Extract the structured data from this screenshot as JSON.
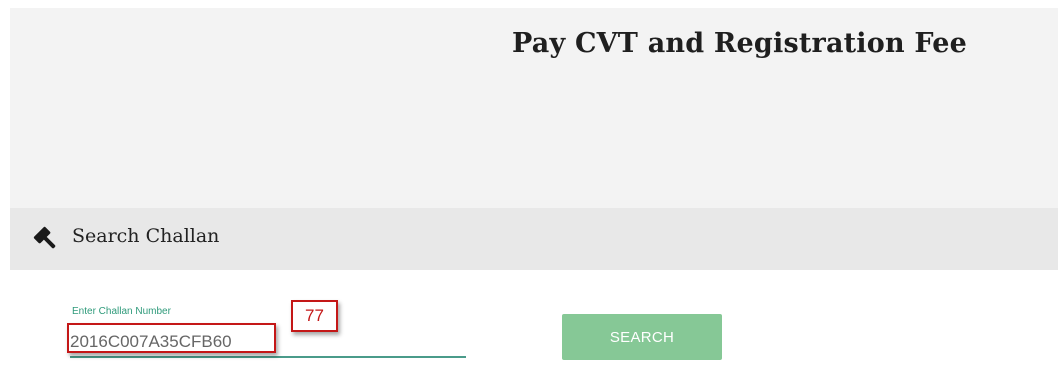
{
  "header": {
    "title": "Pay CVT and Registration Fee"
  },
  "section": {
    "title": "Search Challan",
    "icon": "gavel-icon"
  },
  "form": {
    "challan_label": "Enter Challan Number",
    "challan_value": "2016C007A35CFB60",
    "search_label": "SEARCH"
  },
  "annotation": {
    "badge": "77",
    "color": "#c41717"
  },
  "colors": {
    "button": "#86c896",
    "label": "#2e9a7a",
    "underline": "#4a9b8a"
  }
}
